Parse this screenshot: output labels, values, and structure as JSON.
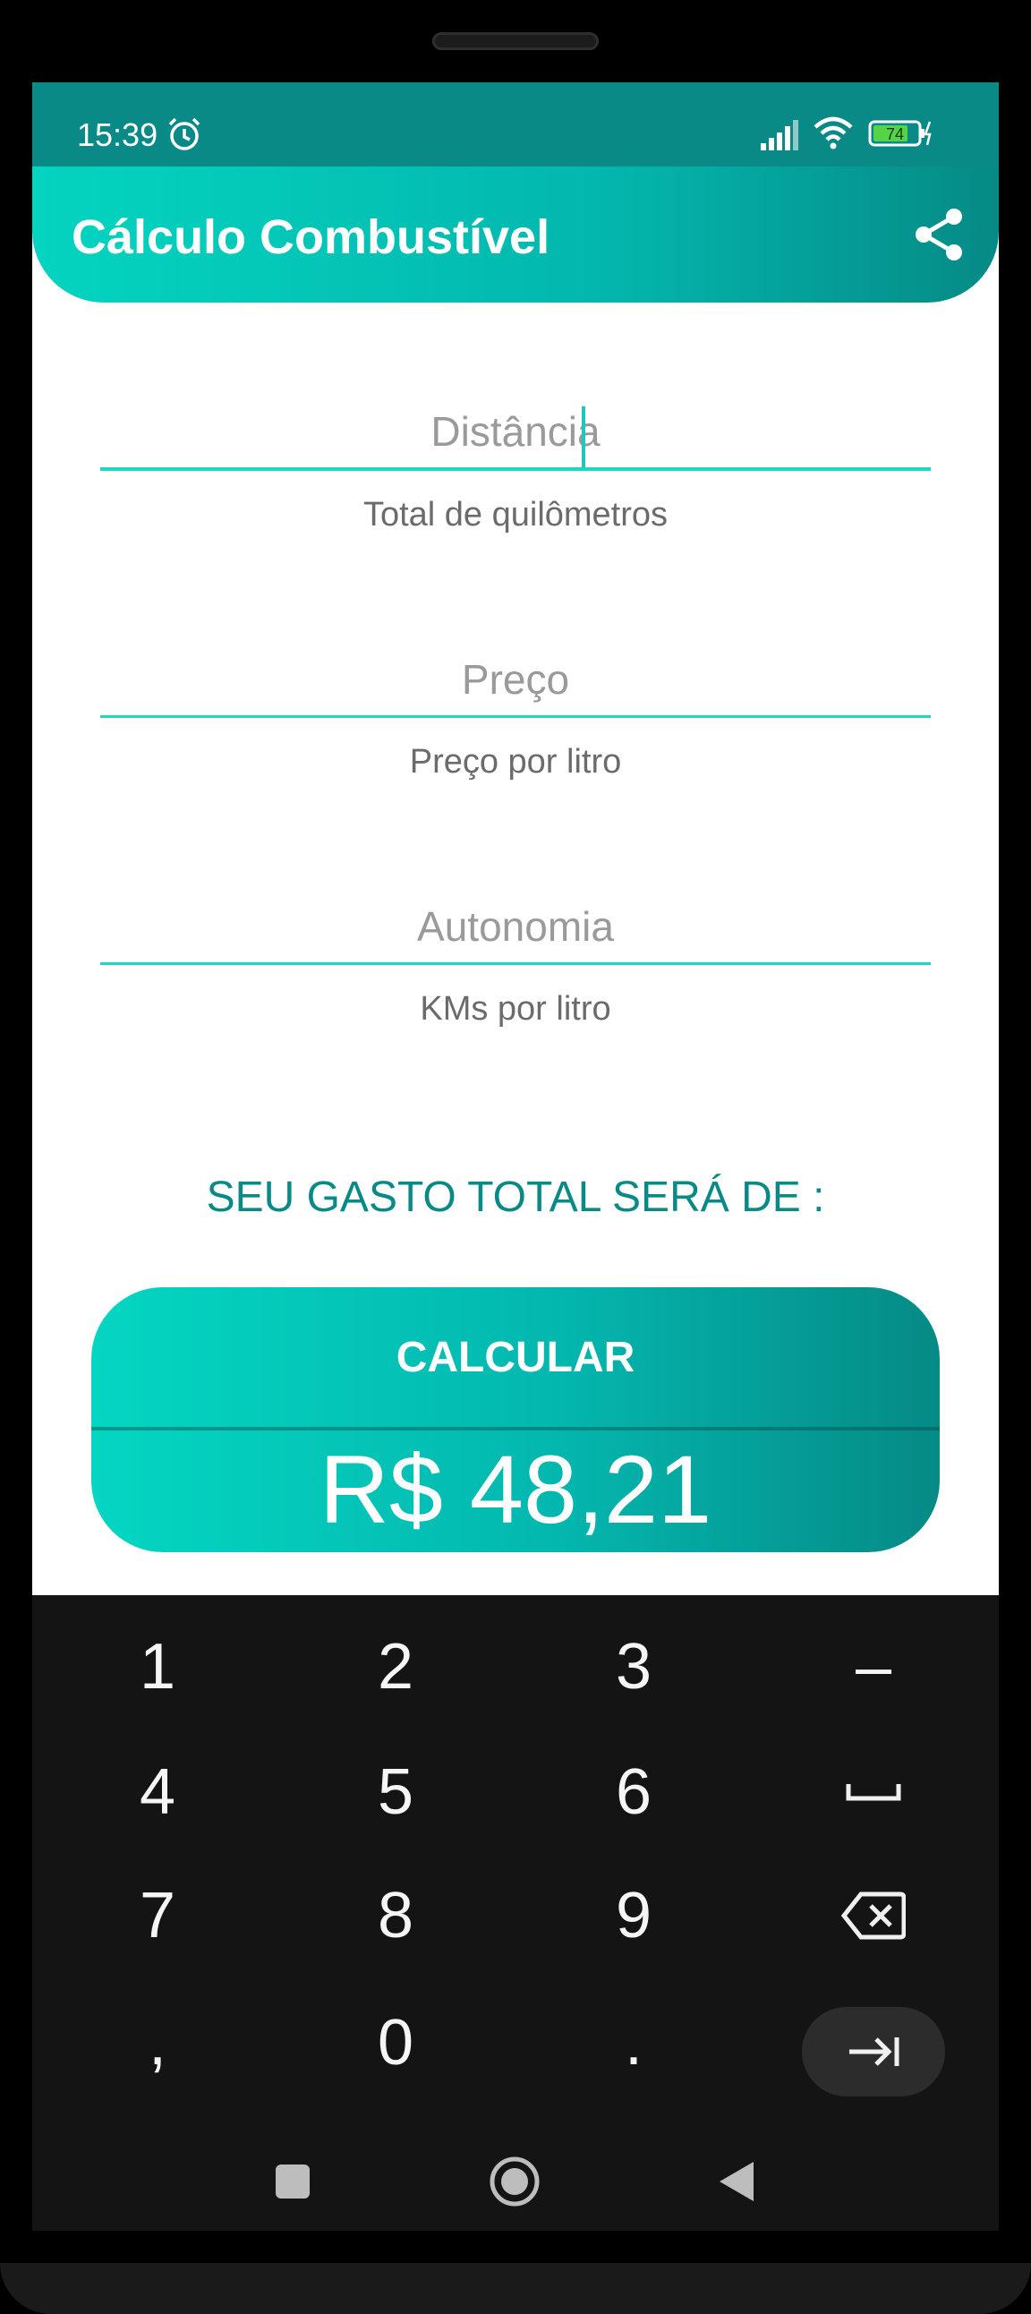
{
  "status_bar": {
    "time": "15:39",
    "battery_level": "74",
    "icons": [
      "alarm-icon",
      "signal-icon",
      "wifi-icon",
      "battery-icon",
      "charging-icon"
    ]
  },
  "app_bar": {
    "title": "Cálculo Combustível",
    "share_icon": "share-icon"
  },
  "form": {
    "distance": {
      "placeholder": "Distância",
      "value": "",
      "hint": "Total de quilômetros"
    },
    "price": {
      "placeholder": "Preço",
      "value": "",
      "hint": "Preço por litro"
    },
    "autonomy": {
      "placeholder": "Autonomia",
      "value": "",
      "hint": "KMs por litro"
    }
  },
  "result": {
    "label": "SEU GASTO TOTAL SERÁ DE :",
    "button_label": "CALCULAR",
    "value": "R$ 48,21"
  },
  "keyboard": {
    "rows": [
      [
        "1",
        "2",
        "3",
        "–"
      ],
      [
        "4",
        "5",
        "6",
        "space-key"
      ],
      [
        "7",
        "8",
        "9",
        "backspace-key"
      ],
      [
        ",",
        "0",
        ".",
        "enter-key"
      ]
    ]
  },
  "navigation": {
    "icons": [
      "recents-icon",
      "home-icon",
      "back-icon"
    ]
  },
  "colors": {
    "accent": "#0a8a86",
    "gradient_start": "#04d4c0",
    "gradient_end": "#068a86",
    "field_line": "#1fd6c4",
    "keyboard_bg": "#141414"
  }
}
